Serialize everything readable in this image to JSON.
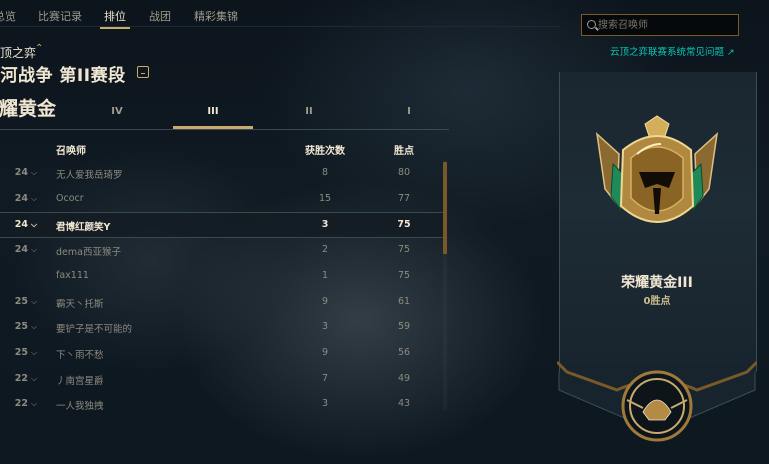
{
  "nav": {
    "tabs": [
      {
        "label": "总览"
      },
      {
        "label": "比赛记录"
      },
      {
        "label": "排位",
        "active": true
      },
      {
        "label": "战团"
      },
      {
        "label": "精彩集锦"
      }
    ]
  },
  "ranking": {
    "mode_label": "云顶之弈",
    "season_title": "银河战争 第II赛段",
    "tier_name": "荣耀黄金",
    "division_tabs": [
      "IV",
      "III",
      "II",
      "I"
    ],
    "active_division": "III",
    "columns": {
      "summoner": "召唤师",
      "wins": "获胜次数",
      "lp": "胜点"
    },
    "rows": [
      {
        "rank": "24",
        "name": "无人爱我岳琦罗",
        "wins": "8",
        "lp": "80"
      },
      {
        "rank": "24",
        "name": "Ococr",
        "wins": "15",
        "lp": "77"
      },
      {
        "rank": "24",
        "name": "君博红颜笑Y",
        "wins": "3",
        "lp": "75",
        "current": true
      },
      {
        "rank": "24",
        "name": "dema西亚猴子",
        "wins": "2",
        "lp": "75"
      },
      {
        "rank": "",
        "name": "fax111",
        "wins": "1",
        "lp": "75"
      },
      {
        "rank": "25",
        "name": "霸天丶托斯",
        "wins": "9",
        "lp": "61"
      },
      {
        "rank": "25",
        "name": "要铲子是不可能的",
        "wins": "3",
        "lp": "59"
      },
      {
        "rank": "25",
        "name": "下丶雨不愁",
        "wins": "9",
        "lp": "56"
      },
      {
        "rank": "22",
        "name": "丿南宫星爵",
        "wins": "7",
        "lp": "49"
      },
      {
        "rank": "22",
        "name": "一人我独拽",
        "wins": "3",
        "lp": "43"
      }
    ]
  },
  "sidebar": {
    "search_placeholder": "搜索召唤师",
    "faq_link": "云顶之弈联赛系统常见问题",
    "rank_name": "荣耀黄金III",
    "rank_lp": "0胜点"
  },
  "colors": {
    "gold": "#c8aa6e",
    "gold_dark": "#785a28",
    "text_light": "#f0e6d2",
    "teal_link": "#0ac8b9",
    "emblem_green": "#1e8a5a"
  }
}
